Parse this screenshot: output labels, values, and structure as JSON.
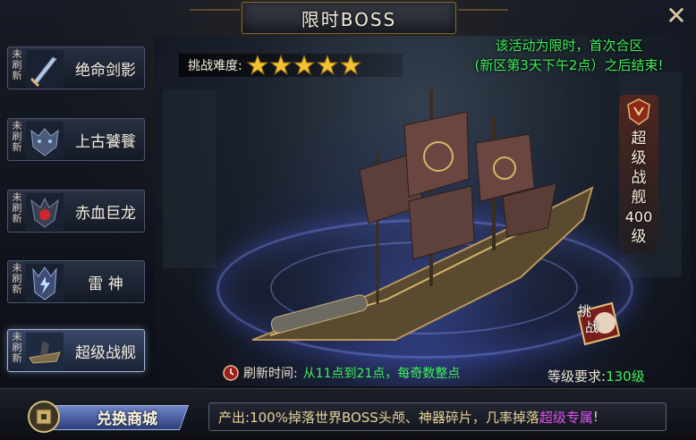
{
  "window": {
    "title": "限时BOSS",
    "close_glyph": "✕"
  },
  "boss_list": [
    {
      "flag": "未刷新",
      "name": "绝命剑影",
      "icon": "sword-icon"
    },
    {
      "flag": "未刷新",
      "name": "上古饕餮",
      "icon": "beast-head-icon"
    },
    {
      "flag": "未刷新",
      "name": "赤血巨龙",
      "icon": "red-dragon-icon"
    },
    {
      "flag": "未刷新",
      "name": "雷 神",
      "icon": "thunder-god-icon"
    },
    {
      "flag": "未刷新",
      "name": "超级战舰",
      "icon": "battleship-icon",
      "selected": true
    }
  ],
  "difficulty": {
    "label": "挑战难度:",
    "stars": 5
  },
  "notice": {
    "line1": "该活动为限时，首次合区",
    "line2": "(新区第3天下午2点）之后结束!"
  },
  "boss_badge": {
    "line1": "超",
    "line2": "级",
    "line3": "战",
    "line4": "舰",
    "level": "400",
    "level_suffix": "级"
  },
  "challenge_button": {
    "label1": "挑",
    "label2": "战"
  },
  "refresh": {
    "label": "刷新时间:",
    "value": "从11点到21点，每奇数整点"
  },
  "level_requirement": {
    "label": "等级要求:",
    "value": "130级"
  },
  "shop_button": {
    "label": "兑换商城"
  },
  "output": {
    "prefix": "产出:",
    "text": "100%掉落世界BOSS头颅、神器碎片，几率掉落",
    "highlight": "超级专属",
    "suffix": "!"
  },
  "colors": {
    "green_text": "#3ff05b",
    "highlight_text": "#e24ef0",
    "gold_text": "#e8d39a",
    "star": "#f2c230"
  }
}
